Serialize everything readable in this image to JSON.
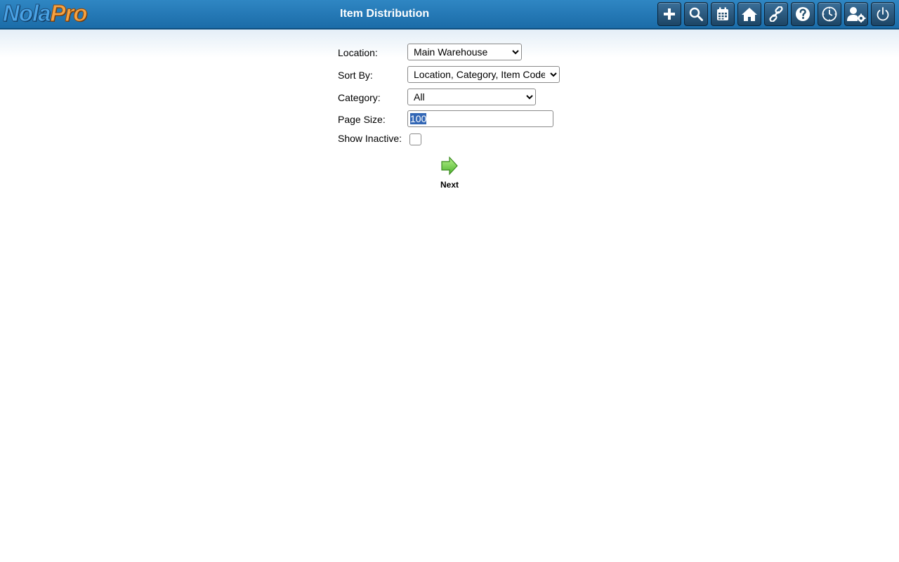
{
  "brand": {
    "logo_part1": "Nola",
    "logo_part2": "Pro"
  },
  "header": {
    "title": "Item Distribution"
  },
  "toolbar": {
    "buttons": [
      {
        "icon": "plus-icon"
      },
      {
        "icon": "search-icon"
      },
      {
        "icon": "calendar-icon"
      },
      {
        "icon": "home-icon"
      },
      {
        "icon": "link-icon"
      },
      {
        "icon": "help-icon"
      },
      {
        "icon": "clock-icon"
      },
      {
        "icon": "user-settings-icon"
      },
      {
        "icon": "power-icon"
      }
    ]
  },
  "form": {
    "location_label": "Location:",
    "location_value": "Main Warehouse",
    "sort_label": "Sort By:",
    "sort_value": "Location, Category, Item Code",
    "category_label": "Category:",
    "category_value": "All",
    "page_size_label": "Page Size:",
    "page_size_value": "100",
    "show_inactive_label": "Show Inactive:",
    "show_inactive_checked": false,
    "next_label": "Next"
  },
  "colors": {
    "header_bg": "#2a7dbb",
    "toolbar_button_bg": "#24506f",
    "next_arrow": "#6fd14a"
  }
}
